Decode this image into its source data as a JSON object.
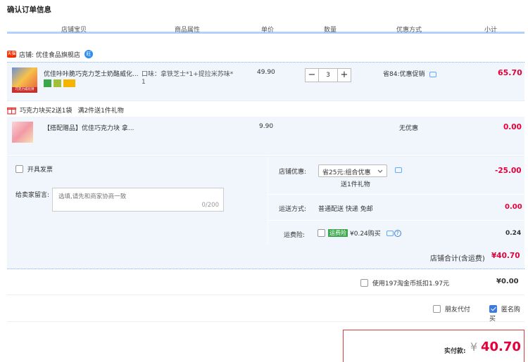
{
  "page": {
    "title": "确认订单信息"
  },
  "columns": [
    "店铺宝贝",
    "商品属性",
    "单价",
    "数量",
    "优惠方式",
    "小计"
  ],
  "shop": {
    "badge": "天猫",
    "label": "店铺: 优佳食品旗舰店",
    "ww": "旺"
  },
  "item": {
    "name": "优佳咔咔脆巧克力芝士奶酪威化...",
    "attr_line1": "口味：拿铁芝士*1+提拉米苏味*",
    "attr_line2": "1",
    "price": "49.90",
    "qty": "3",
    "minus": "−",
    "plus": "+",
    "promo": "省84:优惠促销",
    "subtotal": "65.70",
    "thumb_caption": "巧克力威化饼"
  },
  "gift_promo": {
    "name": "巧克力块买2送1袋",
    "detail": "满2件送1件礼物"
  },
  "gift_item": {
    "name": "【搭配赠品】优佳巧克力块 拿...",
    "price": "9.90",
    "promo": "无优惠",
    "subtotal": "0.00"
  },
  "invoice": {
    "label": "开具发票"
  },
  "message": {
    "label": "给卖家留言:",
    "placeholder": "选填,请先和商家协商一致",
    "counter": "0/200"
  },
  "shop_discount": {
    "label": "店铺优惠:",
    "selected": "省25元:组合优惠",
    "extra": "送1件礼物",
    "value": "-25.00"
  },
  "shipping": {
    "label": "运送方式:",
    "method": "普通配送 快递 免邮",
    "value": "0.00"
  },
  "insurance": {
    "label": "运费险:",
    "tag": "运费险",
    "desc": "¥0.24购买",
    "help": "?",
    "value": "0.24"
  },
  "shop_total": {
    "label": "店铺合计(含运费)",
    "value": "¥40.70"
  },
  "coin": {
    "label": "使用197淘金币抵扣1.97元",
    "value": "¥0.00"
  },
  "pay_options": {
    "friend_pay": "朋友代付",
    "anonymous": "匿名购买"
  },
  "final": {
    "label": "实付款:",
    "currency": "¥",
    "amount": "40.70"
  },
  "colors": {
    "accent_red": "#f40",
    "price_red": "#e4003a",
    "light_blue_bg": "#f1f6fd",
    "header_blue": "#b2d1ff",
    "checkbox_blue": "#3d7bdf"
  }
}
